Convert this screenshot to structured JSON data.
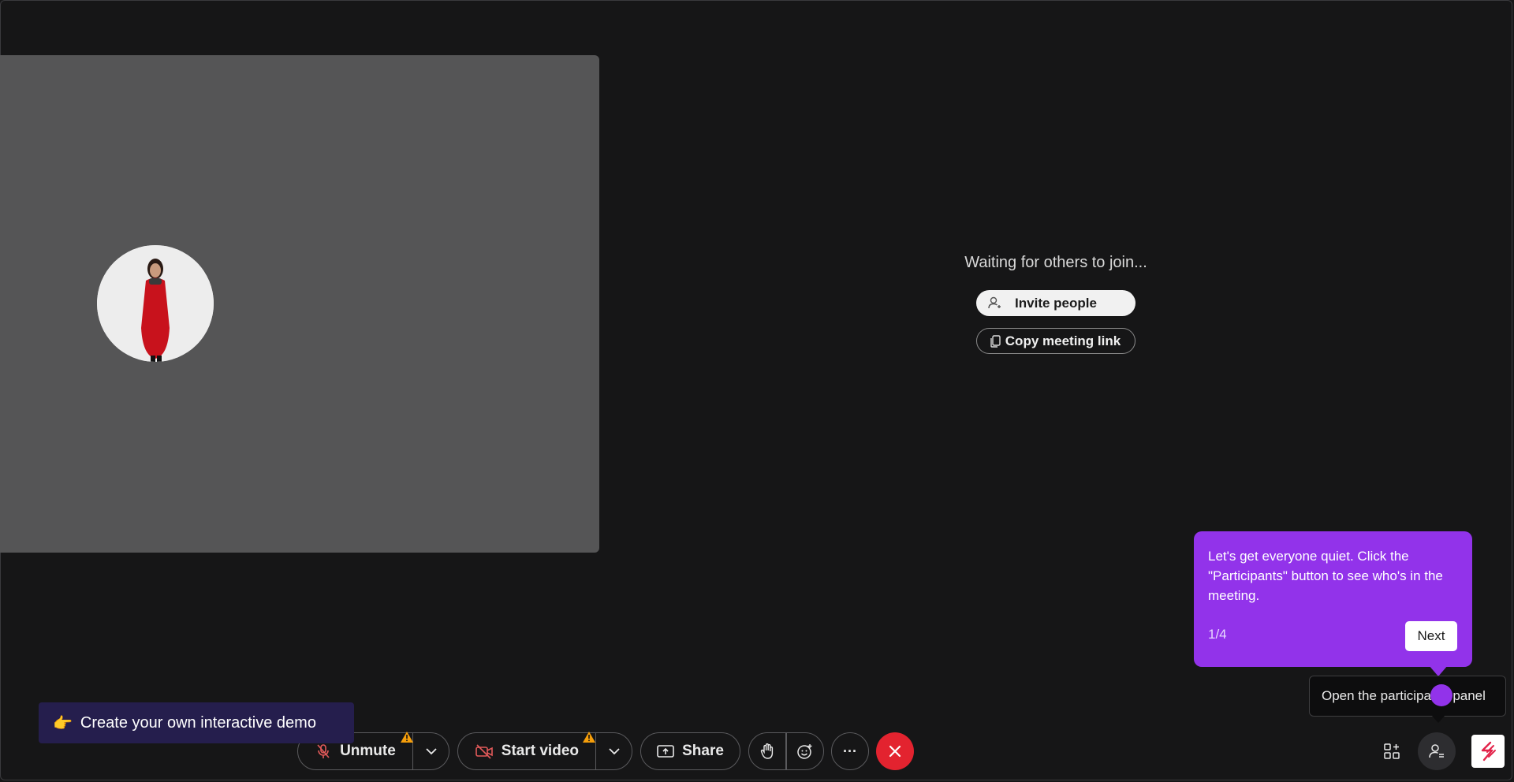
{
  "meeting": {
    "waiting_text": "Waiting for others to join...",
    "invite_label": "Invite people",
    "copy_link_label": "Copy meeting link"
  },
  "tour": {
    "text": "Let's get everyone quiet. Click the \"Participants\" button to see who's in the meeting.",
    "step": "1/4",
    "next_label": "Next",
    "color": "#9233ea"
  },
  "hint": {
    "text": "Open the participants panel"
  },
  "demo_banner": {
    "emoji": "👉",
    "label": "Create your own interactive demo"
  },
  "controls": {
    "unmute_label": "Unmute",
    "start_video_label": "Start video",
    "share_label": "Share",
    "more_label": "···"
  },
  "colors": {
    "end_call": "#e3232f",
    "warning": "#f59e0b"
  }
}
